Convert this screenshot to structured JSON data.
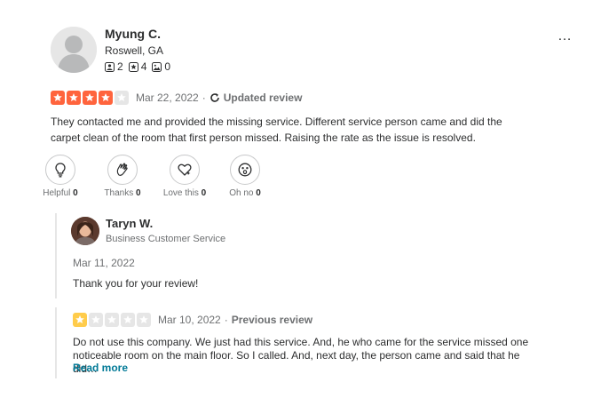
{
  "reviewer": {
    "name": "Myung C.",
    "location": "Roswell, GA",
    "friends_count": "2",
    "reviews_count": "4",
    "photos_count": "0"
  },
  "review": {
    "rating": 4,
    "max_rating": 5,
    "date": "Mar 22, 2022",
    "separator": "·",
    "updated_label": "Updated review",
    "text": "They contacted me and provided the missing service. Different service person came and did the carpet clean of the room that first person missed. Raising the rate as the issue is resolved."
  },
  "reactions": [
    {
      "label": "Helpful",
      "count": "0",
      "icon": "lightbulb-icon"
    },
    {
      "label": "Thanks",
      "count": "0",
      "icon": "clapping-hands-icon"
    },
    {
      "label": "Love this",
      "count": "0",
      "icon": "heart-icon"
    },
    {
      "label": "Oh no",
      "count": "0",
      "icon": "surprised-face-icon"
    }
  ],
  "business_reply": {
    "name": "Taryn W.",
    "role": "Business Customer Service",
    "date": "Mar 11, 2022",
    "text": "Thank you for your review!"
  },
  "previous_review": {
    "rating": 1,
    "date": "Mar 10, 2022",
    "separator": "·",
    "label": "Previous review",
    "text": "Do not use this company. We just had this service. And, he who came for the service missed one noticeable room on the main floor. So I called. And, next day, the person came and said that he did…",
    "read_more": "Read more"
  },
  "more_menu": "…",
  "colors": {
    "star_4": "#ff643d",
    "star_1": "#ffcc4b",
    "star_empty": "#e6e6e6",
    "link": "#027a97",
    "muted": "#6e7072",
    "text": "#2d2e2f"
  }
}
